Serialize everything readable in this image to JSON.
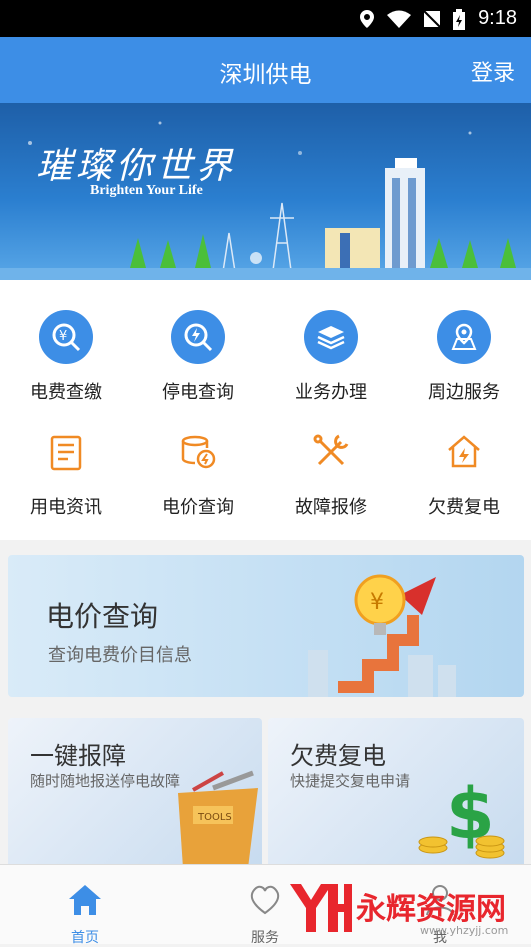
{
  "status": {
    "time": "9:18"
  },
  "header": {
    "title": "深圳供电",
    "login": "登录"
  },
  "banner": {
    "slogan": "璀璨你世界",
    "sub": "Brighten Your Life"
  },
  "grid": [
    {
      "label": "电费查缴",
      "icon": "yuan-search-icon"
    },
    {
      "label": "停电查询",
      "icon": "power-search-icon"
    },
    {
      "label": "业务办理",
      "icon": "layers-icon"
    },
    {
      "label": "周边服务",
      "icon": "map-pin-icon"
    },
    {
      "label": "用电资讯",
      "icon": "news-icon"
    },
    {
      "label": "电价查询",
      "icon": "coin-stack-icon"
    },
    {
      "label": "故障报修",
      "icon": "tools-icon"
    },
    {
      "label": "欠费复电",
      "icon": "house-power-icon"
    }
  ],
  "card_price": {
    "title": "电价查询",
    "subtitle": "查询电费价目信息"
  },
  "card_fault": {
    "title": "一键报障",
    "subtitle": "随时随地报送停电故障"
  },
  "card_arrears": {
    "title": "欠费复电",
    "subtitle": "快捷提交复电申请"
  },
  "tabs": [
    {
      "label": "首页",
      "icon": "home-icon",
      "active": true
    },
    {
      "label": "服务",
      "icon": "service-icon",
      "active": false
    },
    {
      "label": "我",
      "icon": "user-icon",
      "active": false
    }
  ],
  "watermark": {
    "text": "永辉资源网",
    "url": "www.yhzyjj.com"
  },
  "colors": {
    "primary": "#3d8ee6",
    "orange": "#f08a24",
    "red": "#e8262d"
  }
}
